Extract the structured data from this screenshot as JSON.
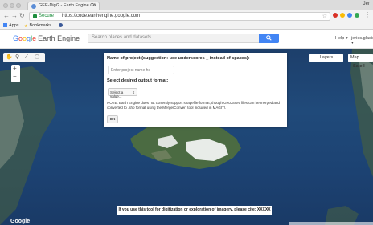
{
  "browser": {
    "tab_title": "GEE-Digi? - Earth Engine Co...",
    "corner_name": "Jer",
    "secure_label": "Secure",
    "url": "https://code.earthengine.google.com",
    "bookmarks": [
      {
        "label": "Apps",
        "icon": "apps-grid-icon"
      },
      {
        "label": "Bookmarks",
        "icon": "star-icon"
      }
    ]
  },
  "header": {
    "logo_google": [
      "G",
      "o",
      "o",
      "g",
      "l",
      "e"
    ],
    "logo_product": "Earth Engine",
    "search_placeholder": "Search places and datasets...",
    "help_label": "Help ▾",
    "user_label": "jeries.glacio ▾"
  },
  "map": {
    "layers_label": "Layers",
    "map_label": "Map",
    "satellite_label": "Satell",
    "watermark": "Google"
  },
  "dialog": {
    "title": "Name of project (suggestion: use underscores _ instead of spaces):",
    "input_placeholder": "Enter project name he",
    "format_label": "Select desired output format:",
    "select_value": "Select a value...",
    "note": "NOTE: Earth Engine does not currently support shapefile format, though GeoJSON files can be merged and converted to .shp format using the Merge/Convert tool included in MAGIT!.",
    "ok_label": "OK"
  },
  "citation": "If you use this tool for digitization or exploration of imagery, please cite: XXXXX"
}
